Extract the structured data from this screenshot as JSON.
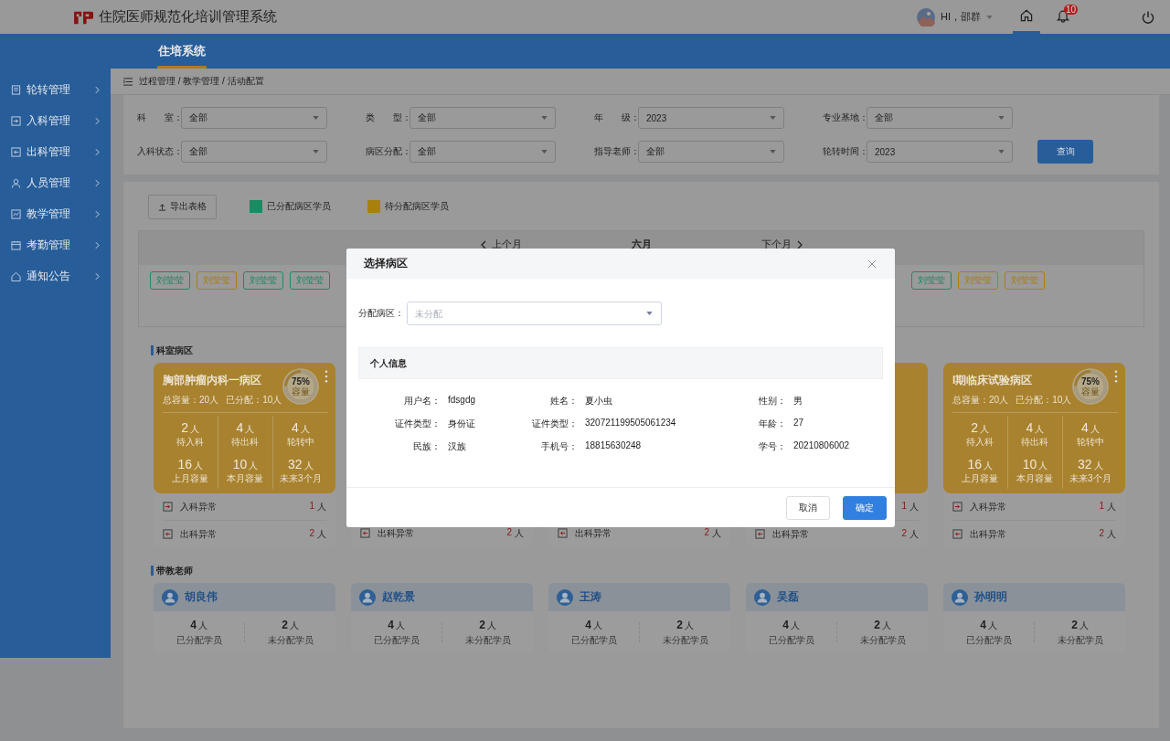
{
  "header": {
    "title": "住院医师规范化培训管理系统",
    "greeting": "HI，邵群",
    "notifications": "10",
    "nav": [
      {
        "kind": "home",
        "selected": true
      },
      {
        "kind": "bell",
        "selected": false
      }
    ]
  },
  "top_tabs": [
    {
      "label": "住培系统",
      "selected": true
    }
  ],
  "sidebar": {
    "items": [
      {
        "label": "轮转管理",
        "kind": "doc"
      },
      {
        "label": "入科管理",
        "kind": "in"
      },
      {
        "label": "出科管理",
        "kind": "out"
      },
      {
        "label": "人员管理",
        "kind": "user"
      },
      {
        "label": "教学管理",
        "kind": "chart"
      },
      {
        "label": "考勤管理",
        "kind": "calendar"
      },
      {
        "label": "通知公告",
        "kind": "home"
      }
    ]
  },
  "breadcrumb": "过程管理 / 教学管理 / 活动配置",
  "filters": [
    {
      "label": "科　　室：",
      "value": "全部"
    },
    {
      "label": "类　　型：",
      "value": "全部"
    },
    {
      "label": "年　　级：",
      "value": "2023"
    },
    {
      "label": "专业基地：",
      "value": "全部"
    },
    {
      "label": "入科状态：",
      "value": "全部"
    },
    {
      "label": "病区分配：",
      "value": "全部"
    },
    {
      "label": "指导老师：",
      "value": "全部"
    },
    {
      "label": "轮转时间：",
      "value": "2023"
    }
  ],
  "query_button": "查询",
  "toolbar": {
    "export_button": "导出表格",
    "legend": [
      {
        "label": "已分配病区学员",
        "color": "#1d8a64"
      },
      {
        "label": "待分配病区学员",
        "color": "#a8800c"
      }
    ]
  },
  "month_nav": {
    "prev": "上个月",
    "current": "六月",
    "next": "下个月"
  },
  "tags": {
    "left": [
      {
        "label": "刘莹莹",
        "color": "#1d8a64"
      },
      {
        "label": "刘莹莹",
        "color": "#a8800c"
      },
      {
        "label": "刘莹莹",
        "color": "#1d8a64"
      },
      {
        "label": "刘莹莹",
        "color": "#1d8a64"
      }
    ],
    "right": [
      {
        "label": "刘莹莹",
        "color": "#1d8a64"
      },
      {
        "label": "刘莹莹",
        "color": "#a8800c"
      },
      {
        "label": "刘莹莹",
        "color": "#a8800c"
      }
    ]
  },
  "wards_title": "科室病区",
  "wards": [
    {
      "name": "胸部肿瘤内科一病区",
      "total": "总容量：20人",
      "assigned": "已分配：10人",
      "ring": {
        "text": "75%",
        "sub": "容量"
      },
      "stats": [
        {
          "value": "2",
          "unit": "人",
          "label": "待入科"
        },
        {
          "value": "4",
          "unit": "人",
          "label": "待出科"
        },
        {
          "value": "4",
          "unit": "人",
          "label": "轮转中"
        },
        {
          "value": "16",
          "unit": "人",
          "label": "上月容量"
        },
        {
          "value": "10",
          "unit": "人",
          "label": "本月容量"
        },
        {
          "value": "32",
          "unit": "人",
          "label": "未来3个月"
        }
      ],
      "rows": [
        {
          "kind": "in",
          "label": "入科异常",
          "value": "1",
          "unit": "人"
        },
        {
          "kind": "out",
          "label": "出科异常",
          "value": "2",
          "unit": "人"
        }
      ]
    },
    {
      "rows": [
        {
          "kind": "out",
          "label": "出科异常",
          "value": "2",
          "unit": "人"
        }
      ]
    },
    {
      "rows": [
        {
          "kind": "out",
          "label": "出科异常",
          "value": "2",
          "unit": "人"
        }
      ]
    },
    {
      "rows": [
        {
          "kind": "in",
          "value": "1",
          "unit": "人"
        },
        {
          "kind": "out",
          "label": "出科异常",
          "value": "2",
          "unit": "人"
        }
      ]
    },
    {
      "name": "I期临床试验病区",
      "total": "总容量：20人",
      "assigned": "已分配：10人",
      "ring": {
        "text": "75%",
        "sub": "容量"
      },
      "stats": [
        {
          "value": "2",
          "unit": "人",
          "label": "待入科"
        },
        {
          "value": "4",
          "unit": "人",
          "label": "待出科"
        },
        {
          "value": "4",
          "unit": "人",
          "label": "轮转中"
        },
        {
          "value": "16",
          "unit": "人",
          "label": "上月容量"
        },
        {
          "value": "10",
          "unit": "人",
          "label": "本月容量"
        },
        {
          "value": "32",
          "unit": "人",
          "label": "未来3个月"
        }
      ],
      "rows": [
        {
          "kind": "in",
          "label": "入科异常",
          "value": "1",
          "unit": "人"
        },
        {
          "kind": "out",
          "label": "出科异常",
          "value": "2",
          "unit": "人"
        }
      ]
    }
  ],
  "teachers_title": "带教老师",
  "teachers": [
    {
      "name": "胡良伟",
      "stats": [
        {
          "value": "4",
          "unit": "人",
          "label": "已分配学员"
        },
        {
          "value": "2",
          "unit": "人",
          "label": "未分配学员"
        }
      ]
    },
    {
      "name": "赵乾景",
      "stats": [
        {
          "value": "4",
          "unit": "人",
          "label": "已分配学员"
        },
        {
          "value": "2",
          "unit": "人",
          "label": "未分配学员"
        }
      ]
    },
    {
      "name": "王涛",
      "stats": [
        {
          "value": "4",
          "unit": "人",
          "label": "已分配学员"
        },
        {
          "value": "2",
          "unit": "人",
          "label": "未分配学员"
        }
      ]
    },
    {
      "name": "吴磊",
      "stats": [
        {
          "value": "4",
          "unit": "人",
          "label": "已分配学员"
        },
        {
          "value": "2",
          "unit": "人",
          "label": "未分配学员"
        }
      ]
    },
    {
      "name": "孙明明",
      "stats": [
        {
          "value": "4",
          "unit": "人",
          "label": "已分配学员"
        },
        {
          "value": "2",
          "unit": "人",
          "label": "未分配学员"
        }
      ]
    }
  ],
  "modal": {
    "title": "选择病区",
    "field": {
      "label": "分配病区：",
      "placeholder": "未分配"
    },
    "section_title": "个人信息",
    "info": [
      {
        "label": "用户名：",
        "value": "fdsgdg"
      },
      {
        "label": "姓名：",
        "value": "夏小虫"
      },
      {
        "label": "性别：",
        "value": "男"
      },
      {
        "label": "证件类型：",
        "value": "身份证"
      },
      {
        "label": "证件类型：",
        "value": "320721199505061234"
      },
      {
        "label": "年龄：",
        "value": "27"
      },
      {
        "label": "民族：",
        "value": "汉族"
      },
      {
        "label": "手机号：",
        "value": "18815630248"
      },
      {
        "label": "学号：",
        "value": "20210806002"
      }
    ],
    "buttons": [
      {
        "label": "取消",
        "primary": false
      },
      {
        "label": "确定",
        "primary": true
      }
    ]
  }
}
